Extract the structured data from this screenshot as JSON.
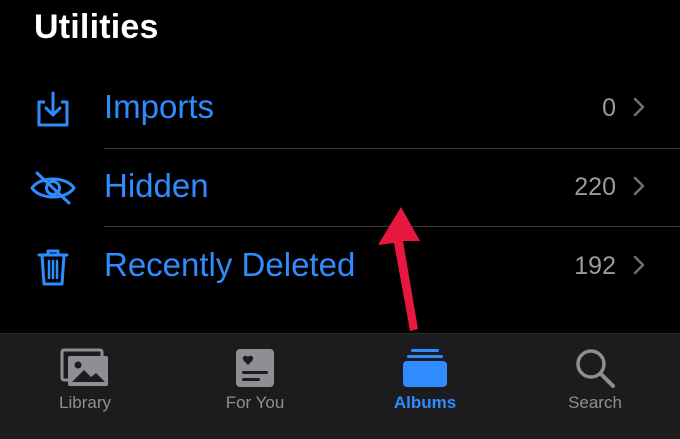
{
  "section": {
    "title": "Utilities"
  },
  "utilities": [
    {
      "icon": "import-icon",
      "label": "Imports",
      "count": "0"
    },
    {
      "icon": "eye-slash-icon",
      "label": "Hidden",
      "count": "220"
    },
    {
      "icon": "trash-icon",
      "label": "Recently Deleted",
      "count": "192"
    }
  ],
  "tabbar": {
    "tabs": [
      {
        "icon": "photo-library-icon",
        "label": "Library"
      },
      {
        "icon": "for-you-icon",
        "label": "For You"
      },
      {
        "icon": "albums-icon",
        "label": "Albums",
        "active": true
      },
      {
        "icon": "search-icon",
        "label": "Search"
      }
    ]
  },
  "colors": {
    "accent": "#2f8cff",
    "background": "#000000",
    "tabbar_background": "#1c1c1e",
    "annotation_arrow": "#e8173f"
  }
}
